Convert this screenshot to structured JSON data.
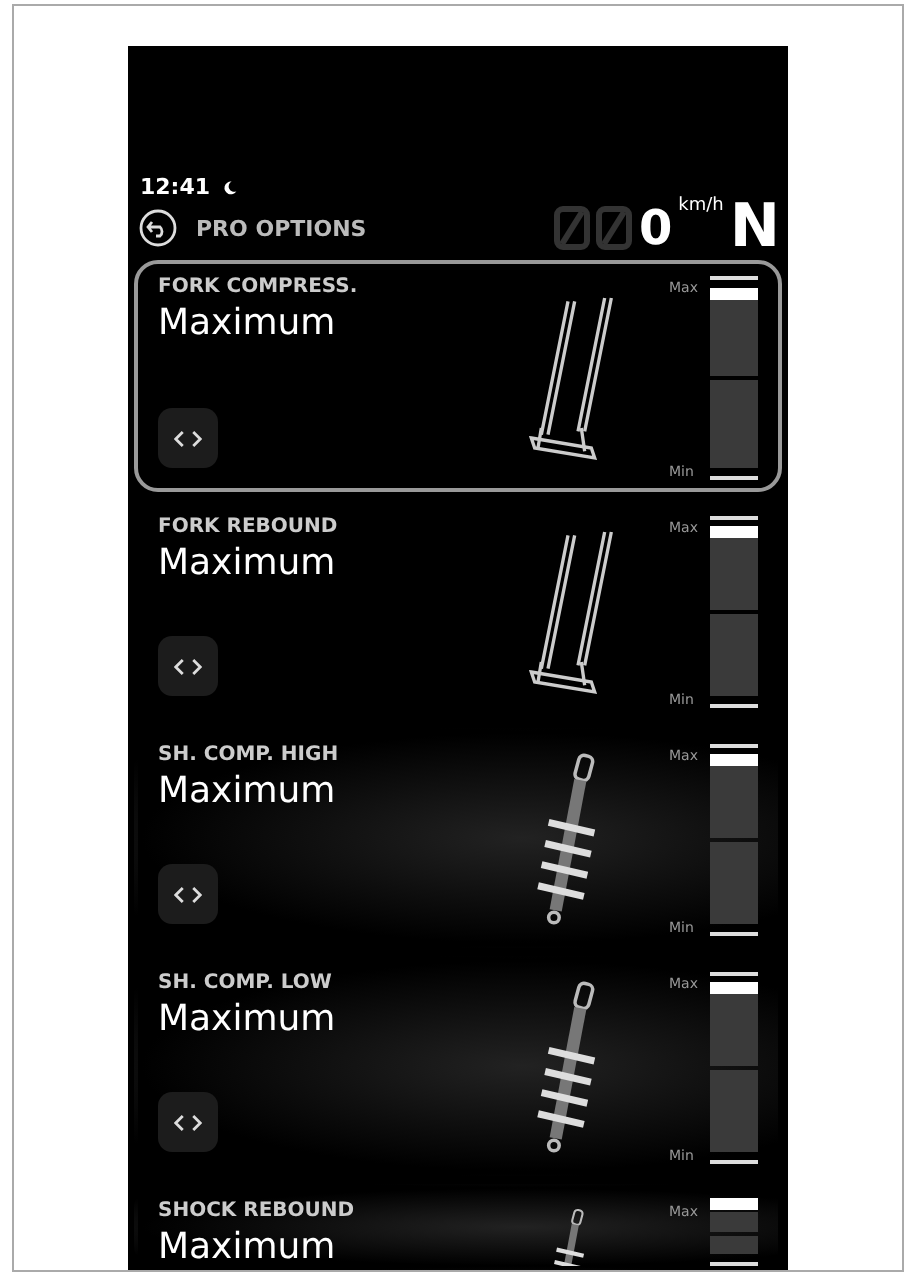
{
  "status_bar": {
    "time": "12:41"
  },
  "header": {
    "title": "PRO OPTIONS",
    "speed": "0",
    "speed_unit": "km/h",
    "gear": "N"
  },
  "settings": [
    {
      "label": "FORK COMPRESS.",
      "value": "Maximum",
      "kind": "fork",
      "selected": true,
      "max_label": "Max",
      "min_label": "Min",
      "level": 1
    },
    {
      "label": "FORK REBOUND",
      "value": "Maximum",
      "kind": "fork",
      "selected": false,
      "max_label": "Max",
      "min_label": "Min",
      "level": 1
    },
    {
      "label": "SH. COMP. HIGH",
      "value": "Maximum",
      "kind": "shock",
      "selected": false,
      "max_label": "Max",
      "min_label": "Min",
      "level": 1
    },
    {
      "label": "SH. COMP. LOW",
      "value": "Maximum",
      "kind": "shock",
      "selected": false,
      "max_label": "Max",
      "min_label": "Min",
      "level": 1
    },
    {
      "label": "SHOCK REBOUND",
      "value": "Maximum",
      "kind": "shock",
      "selected": false,
      "max_label": "Max",
      "level": 1
    }
  ]
}
